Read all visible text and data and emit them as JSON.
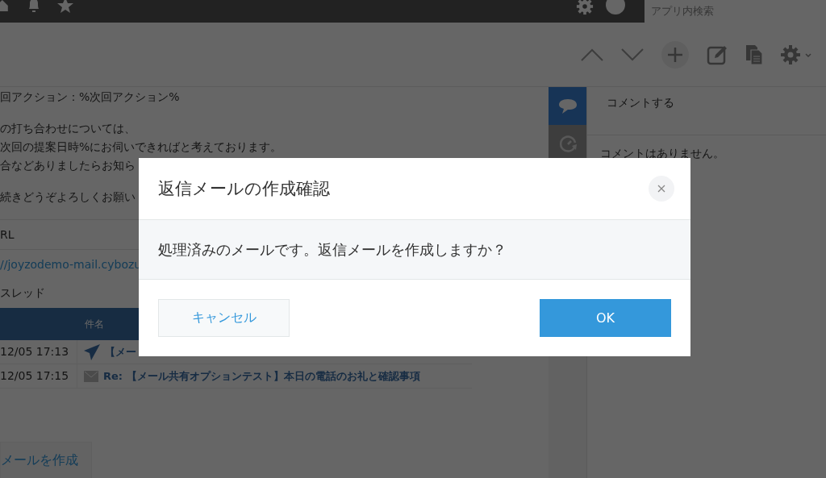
{
  "top_bar": {
    "search": {
      "placeholder": "アプリ内検索"
    }
  },
  "record": {
    "paragraphs": [
      [
        "回アクション：%次回アクション%"
      ],
      [
        "の打ち合わせについては、",
        "次回の提案日時%にお伺いできればと考えております。",
        "合などありましたらお知ら"
      ],
      [
        "続きどうぞよろしくお願い"
      ]
    ],
    "url_field": {
      "label": "RL",
      "value": "//joyzodemo-mail.cybozu"
    },
    "thread": {
      "label": "スレッド",
      "columns": [
        "件名"
      ],
      "rows": [
        {
          "date": "12/05 17:13",
          "kind": "sent",
          "subject": "【メー"
        },
        {
          "date": "12/05 17:15",
          "kind": "received",
          "subject": "Re: 【メール共有オプションテスト】本日の電話のお礼と確認事項"
        }
      ]
    },
    "compose_button": "メールを作成"
  },
  "side_tabs": [
    {
      "kind": "comments",
      "selected": true
    },
    {
      "kind": "history",
      "selected": false
    }
  ],
  "comments": {
    "field": {
      "placeholder": "コメントする"
    },
    "empty_text": "コメントはありません。"
  },
  "dialog": {
    "title": "返信メールの作成確認",
    "message": "処理済みのメールです。返信メールを作成しますか？",
    "buttons": [
      {
        "label": "キャンセル",
        "kind": "secondary"
      },
      {
        "label": "OK",
        "kind": "primary"
      }
    ]
  }
}
